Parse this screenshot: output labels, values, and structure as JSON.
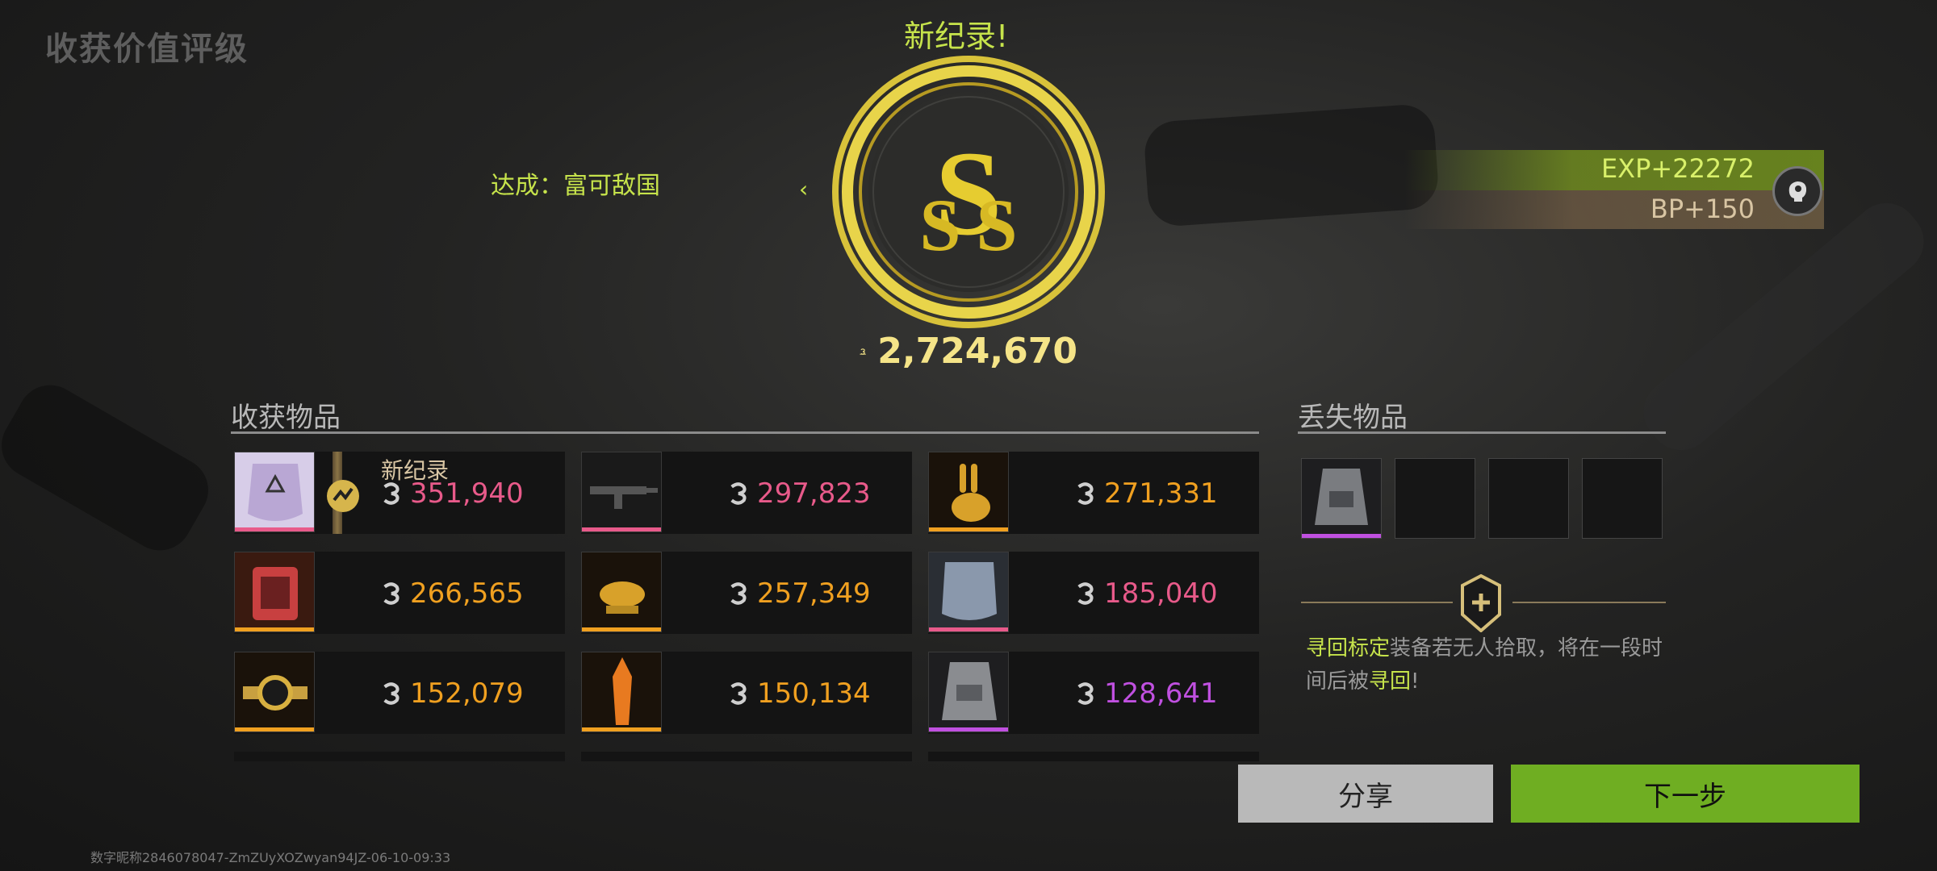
{
  "page_title": "收获价值评级",
  "record_label": "新纪录!",
  "achievement": "达成：富可敌国",
  "rating": "SSS",
  "total_value": "2,724,670",
  "rewards": {
    "exp": "EXP+22272",
    "bp": "BP+150"
  },
  "collected": {
    "title": "收获物品",
    "new_record_label": "新纪录",
    "items": [
      {
        "price": "351,940",
        "rarity_color": "#e85a8a",
        "price_color": "#e85a8a",
        "icon": "armor-plate-icon"
      },
      {
        "price": "297,823",
        "rarity_color": "#e85a8a",
        "price_color": "#e85a8a",
        "icon": "rifle-icon"
      },
      {
        "price": "271,331",
        "rarity_color": "#f0a020",
        "price_color": "#f0a020",
        "icon": "golden-rabbit-icon"
      },
      {
        "price": "266,565",
        "rarity_color": "#f0a020",
        "price_color": "#f0a020",
        "icon": "fuel-canister-icon"
      },
      {
        "price": "257,349",
        "rarity_color": "#f0a020",
        "price_color": "#f0a020",
        "icon": "golden-rat-icon"
      },
      {
        "price": "185,040",
        "rarity_color": "#e85a8a",
        "price_color": "#e85a8a",
        "icon": "armor-plate-icon"
      },
      {
        "price": "152,079",
        "rarity_color": "#f0a020",
        "price_color": "#f0a020",
        "icon": "gold-watch-icon"
      },
      {
        "price": "150,134",
        "rarity_color": "#f0a020",
        "price_color": "#f0a020",
        "icon": "crystal-icon"
      },
      {
        "price": "128,641",
        "rarity_color": "#c050e0",
        "price_color": "#c050e0",
        "icon": "vest-icon"
      }
    ]
  },
  "lost": {
    "title": "丢失物品",
    "retrieve_prefix": "寻回标定",
    "retrieve_mid": "装备若无人拾取，将在一段时间后被",
    "retrieve_word": "寻回",
    "retrieve_suffix": "!"
  },
  "buttons": {
    "share": "分享",
    "next": "下一步"
  },
  "footer": "数字昵称2846078047-ZmZUyXOZwyan94JZ-06-10-09:33"
}
